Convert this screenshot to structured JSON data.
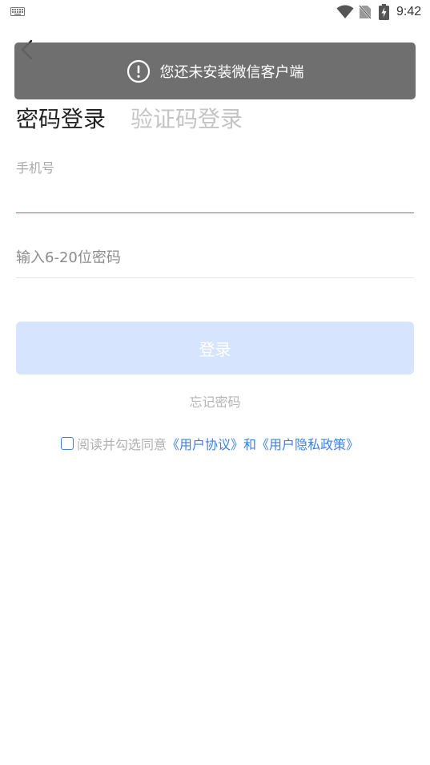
{
  "status_bar": {
    "time": "9:42",
    "icons": [
      "keyboard-icon",
      "wifi-icon",
      "no-sim-icon",
      "battery-charging-icon"
    ]
  },
  "toast": {
    "icon": "exclamation-circle-icon",
    "message": "您还未安装微信客户端"
  },
  "tabs": {
    "password_login": "密码登录",
    "code_login": "验证码登录"
  },
  "form": {
    "phone_label": "手机号",
    "phone_value": "",
    "password_placeholder": "输入6-20位密码",
    "password_value": ""
  },
  "login_button": "登录",
  "forgot_password": "忘记密码",
  "agreement": {
    "checked": false,
    "prefix": "阅读并勾选同意",
    "user_agreement": "《用户协议》",
    "and": "和",
    "privacy_policy": "《用户隐私政策》"
  },
  "colors": {
    "accent": "#3b7ff0",
    "button_disabled": "#d7e4fd",
    "toast_bg": "#646464"
  }
}
